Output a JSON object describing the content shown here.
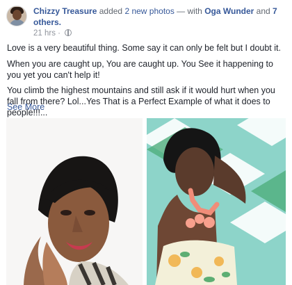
{
  "post": {
    "author_name": "Chizzy Treasure",
    "action_text": "added",
    "photo_count_text": "2 new photos",
    "with_text": "— with",
    "with_name": "Oga Wunder",
    "and_text": "and",
    "others_text": "7 others.",
    "timestamp": "21 hrs",
    "separator": "·",
    "paragraphs": [
      "Love is a very beautiful thing. Some say it can only be felt but I doubt it.",
      "When you are caught up, You are caught up. You See it happening to you yet you can't help it!",
      "You climb the highest mountains and still ask if it would hurt when you fall from there? Lol...Yes That is a Perfect Example of what it does to people!!!..."
    ],
    "see_more": "See More"
  },
  "icons": {
    "privacy": "globe-icon"
  },
  "colors": {
    "link": "#365899",
    "meta": "#90949c",
    "text": "#1d2129",
    "photo_right_bg": "#8dd4c9"
  }
}
